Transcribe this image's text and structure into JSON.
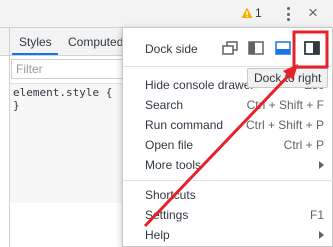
{
  "toolbar": {
    "warning_count": "1",
    "close_glyph": "×",
    "warning_icon": "warning-icon",
    "more_icon": "kebab-icon"
  },
  "panel": {
    "tabs": [
      "Styles",
      "Computed"
    ],
    "filter_placeholder": "Filter",
    "code_line1": "element.style {",
    "code_line2": "}"
  },
  "menu": {
    "dock_side_label": "Dock side",
    "dock_options": [
      "undock-icon",
      "dock-left-icon",
      "dock-bottom-icon",
      "dock-right-icon"
    ],
    "selected_dock": "dock-right-icon",
    "tooltip": "Dock to right",
    "items": [
      {
        "label": "Hide console drawer",
        "shortcut": "Esc"
      },
      {
        "label": "Search",
        "shortcut": "Ctrl + Shift + F"
      },
      {
        "label": "Run command",
        "shortcut": "Ctrl + Shift + P"
      },
      {
        "label": "Open file",
        "shortcut": "Ctrl + P"
      },
      {
        "label": "More tools",
        "shortcut": ""
      },
      {
        "label": "Shortcuts",
        "shortcut": ""
      },
      {
        "label": "Settings",
        "shortcut": "F1"
      },
      {
        "label": "Help",
        "shortcut": ""
      }
    ]
  },
  "colors": {
    "accent": "#1a73e8",
    "annotation_red": "#e8202a",
    "warning": "#f9ab00"
  }
}
